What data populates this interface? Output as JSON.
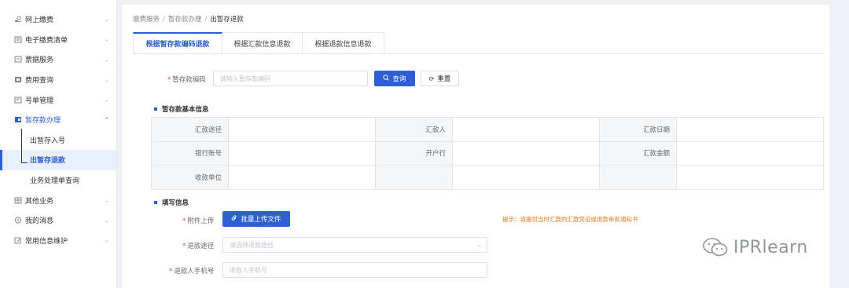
{
  "sidebar": {
    "items": [
      {
        "label": "网上缴费",
        "icon": "hand-pay-icon"
      },
      {
        "label": "电子缴费清单",
        "icon": "list-icon"
      },
      {
        "label": "票据服务",
        "icon": "receipt-icon"
      },
      {
        "label": "费用查询",
        "icon": "search-fee-icon"
      },
      {
        "label": "号单管理",
        "icon": "document-icon"
      },
      {
        "label": "暂存款办理",
        "icon": "wallet-icon"
      },
      {
        "label": "其他业务",
        "icon": "grid-icon"
      },
      {
        "label": "我的消息",
        "icon": "message-icon"
      },
      {
        "label": "常用信息维护",
        "icon": "edit-icon"
      }
    ],
    "sub_items": [
      "出暂存入号",
      "出暂存退款",
      "业务处理单查询"
    ]
  },
  "breadcrumb": {
    "level1": "缴费服务",
    "level2": "暂存款办理",
    "current": "出暂存退款"
  },
  "tabs": [
    "根据暂存款编码退款",
    "根据汇款信息退款",
    "根据退款信息退款"
  ],
  "query": {
    "label": "暂存款编码",
    "placeholder": "请输入暂存款编码",
    "search_button": "查询",
    "reset_button": "重置"
  },
  "basic_info": {
    "title": "暂存款基本信息",
    "rows": [
      [
        "汇款途径",
        "",
        "汇款人",
        "",
        "汇款日期",
        ""
      ],
      [
        "银行账号",
        "",
        "开户行",
        "",
        "汇款金额",
        ""
      ],
      [
        "收款单位",
        "",
        "",
        "",
        "",
        ""
      ]
    ]
  },
  "fill_info": {
    "title": "填写信息",
    "attachment_label": "附件上传",
    "upload_button": "批量上传文件",
    "hint": "提示：请提供当时汇款的汇款凭证或退款审批通知书",
    "refund_method_label": "退款途径",
    "refund_method_placeholder": "请选择退款途径",
    "phone_label": "退款人手机号",
    "phone_placeholder": "退款人手机号"
  },
  "watermark": {
    "text": "IPRlearn"
  },
  "colors": {
    "accent": "#2e5fd6",
    "required": "#e34d4d",
    "hint": "#e07a1e"
  }
}
